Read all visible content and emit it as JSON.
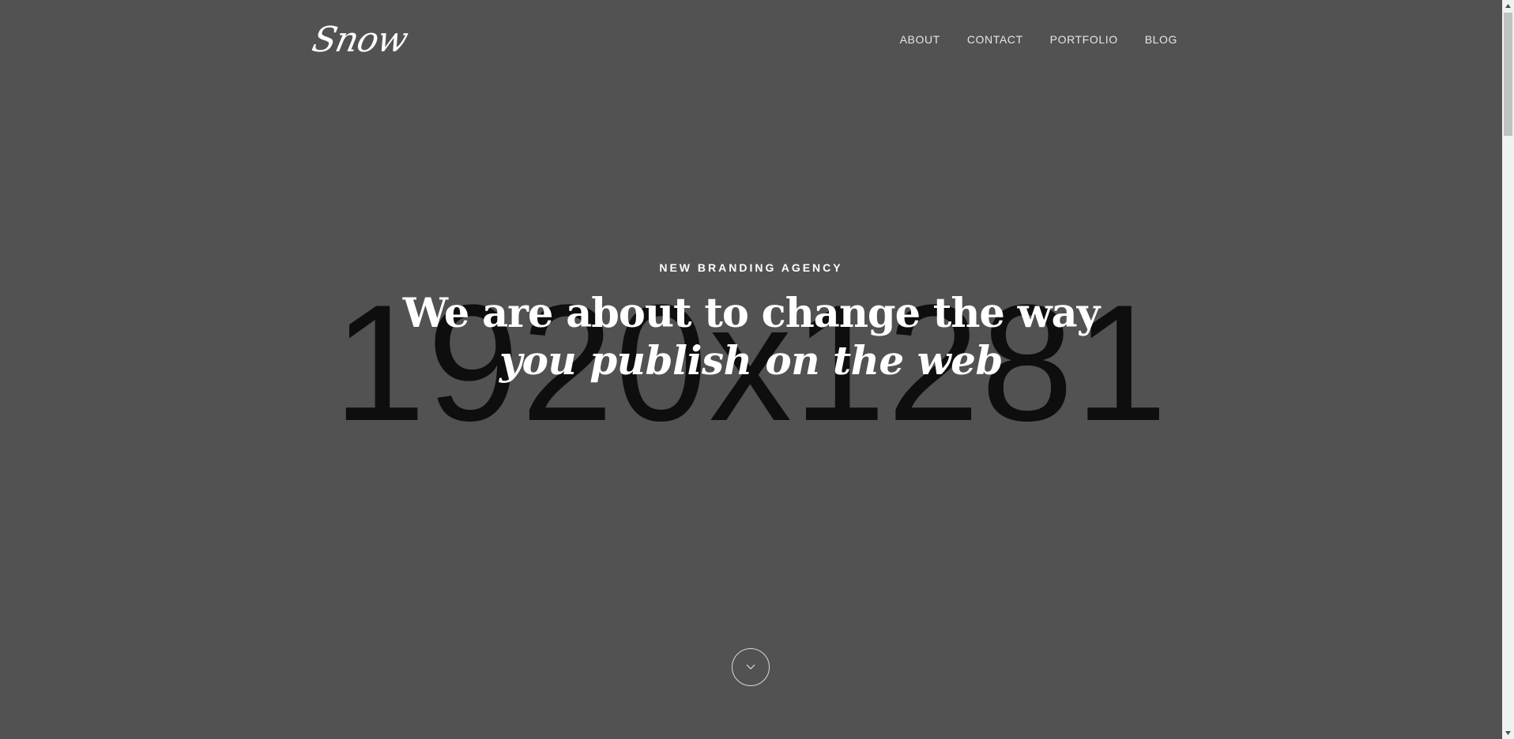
{
  "hero": {
    "placeholder_text": "1920x1281",
    "eyebrow": "NEW BRANDING AGENCY",
    "headline_line1": "We are about to change the way",
    "headline_line2": "you publish on the web"
  },
  "header": {
    "logo": "Snow",
    "nav": {
      "items": [
        {
          "label": "ABOUT"
        },
        {
          "label": "CONTACT"
        },
        {
          "label": "PORTFOLIO"
        },
        {
          "label": "BLOG"
        }
      ]
    }
  },
  "icons": {
    "scroll_down": "chevron-down-icon",
    "scrollbar_up": "scroll-up-arrow-icon",
    "scrollbar_down": "scroll-down-arrow-icon"
  },
  "colors": {
    "background": "#525252",
    "text": "#ffffff",
    "placeholder_text": "#0e0e0e"
  }
}
